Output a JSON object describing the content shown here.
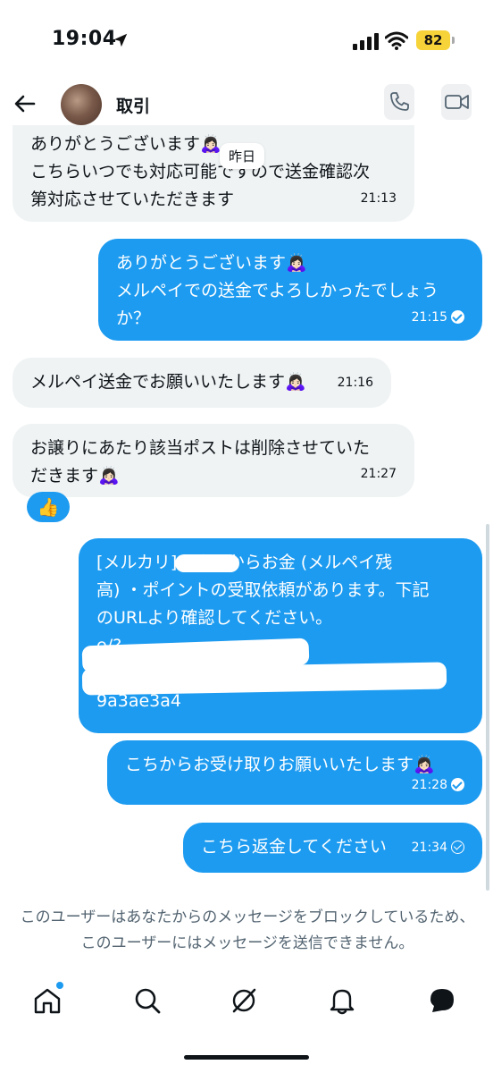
{
  "status_bar": {
    "time": "19:04",
    "battery": "82"
  },
  "header": {
    "title": "取引"
  },
  "date_divider": "昨日",
  "messages": [
    {
      "text": "ありがとうございます🙇🏻‍♀️\nこちらいつでも対応可能ですので送金確認次\n第対応させていただきます",
      "time": "21:13"
    },
    {
      "text": "ありがとうございます🙇🏻‍♀️\nメルペイでの送金でよろしかったでしょう\nか？",
      "time": "21:15"
    },
    {
      "text": "メルペイ送金でお願いいたします🙇🏻‍♀️",
      "time": "21:16"
    },
    {
      "text": "お譲りにあたり該当ポストは削除させていた\nだきます🙇🏻‍♀️",
      "time": "21:27"
    },
    {
      "text": "[メルカリ]K        さんからお金 (メルペイ残\n高) ・ポイントの受取依頼があります。下記\nのURLより確認してください。\n                                                  e/?\n                                                      8\n9a3ae3a4",
      "time": ""
    },
    {
      "text": "こちからお受け取りお願いいたします🙇🏻‍♀️",
      "time": "21:28"
    },
    {
      "text": "こちら返金してください",
      "time": "21:34"
    }
  ],
  "reaction": "👍",
  "blocked_notice": "このユーザーはあなたからのメッセージをブロックしているため、このユーザーにはメッセージを送信できません。",
  "icons": {
    "back": "back-arrow-icon",
    "phone": "phone-icon",
    "video": "video-icon",
    "home": "home-icon",
    "search": "search-icon",
    "grok": "grok-icon",
    "notifications": "bell-icon",
    "messages": "chat-icon"
  },
  "colors": {
    "sent_bubble": "#1d9bf0",
    "received_bubble": "#eff3f4",
    "accent": "#1d9bf0"
  }
}
